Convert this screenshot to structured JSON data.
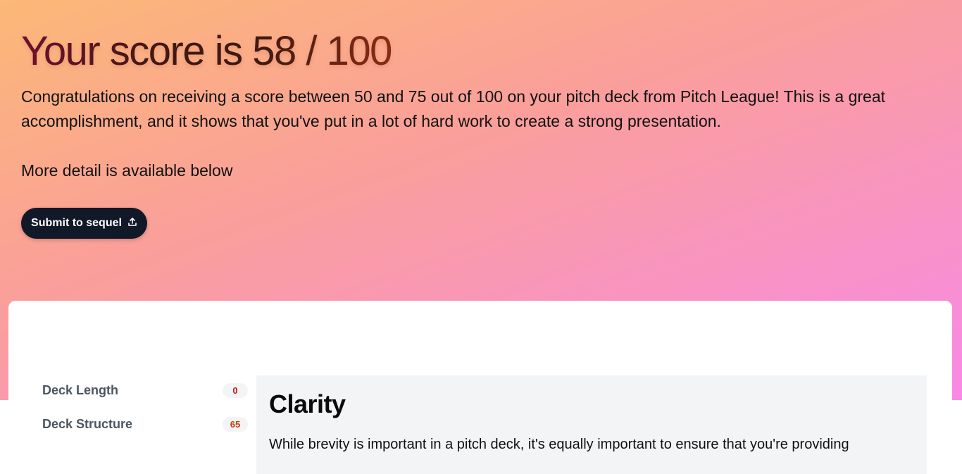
{
  "hero": {
    "title": "Your score is 58 / 100",
    "intro": "Congratulations on receiving a score between 50 and 75 out of 100 on your pitch deck from Pitch League! This is a great accomplishment, and it shows that you've put in a lot of hard work to create a strong presentation.",
    "more_detail": "More detail is available below",
    "submit_label": "Submit to sequel",
    "submit_icon": "upload-icon"
  },
  "sidebar": {
    "items": [
      {
        "label": "Deck Length",
        "score": "0",
        "score_color": "#b91c1c"
      },
      {
        "label": "Deck Structure",
        "score": "65",
        "score_color": "#c2410c"
      }
    ]
  },
  "panel": {
    "title": "Clarity",
    "text": "While brevity is important in a pitch deck, it's equally important to ensure that you're providing"
  },
  "colors": {
    "gradient_start": "#fcb877",
    "gradient_end": "#f889e6",
    "button_bg": "#111827"
  }
}
